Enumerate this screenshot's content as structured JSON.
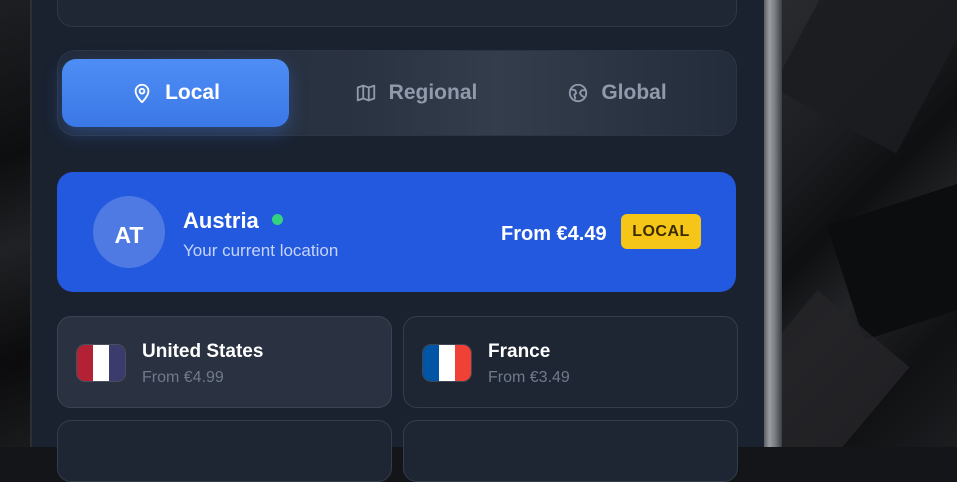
{
  "tabs": [
    {
      "label": "Local",
      "icon": "map-pin-icon",
      "active": true
    },
    {
      "label": "Regional",
      "icon": "map-icon",
      "active": false
    },
    {
      "label": "Global",
      "icon": "globe-icon",
      "active": false
    }
  ],
  "current_location": {
    "code": "AT",
    "country": "Austria",
    "subtitle": "Your current location",
    "price": "From €4.49",
    "badge": "LOCAL",
    "status": "online"
  },
  "countries": [
    {
      "name": "United States",
      "price": "From €4.99",
      "flag_colors": [
        "#b22234",
        "#ffffff",
        "#3c3b6e"
      ]
    },
    {
      "name": "France",
      "price": "From €3.49",
      "flag_colors": [
        "#0055a4",
        "#ffffff",
        "#ef4135"
      ]
    }
  ],
  "colors": {
    "accent": "#3b78e7",
    "card_highlight": "#2359de",
    "badge": "#f5c518",
    "status_online": "#34d17f"
  }
}
